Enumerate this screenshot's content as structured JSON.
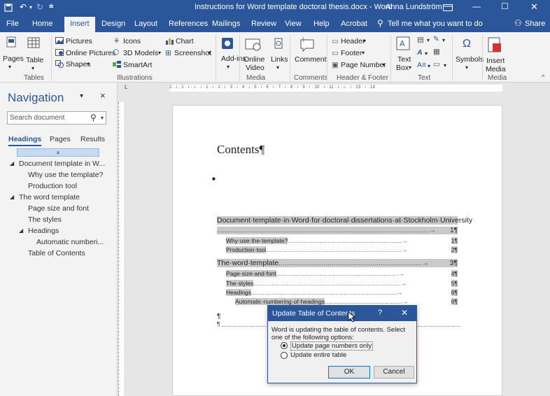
{
  "titlebar": {
    "doc_title": "Instructions for Word template doctoral thesis.docx - Word",
    "user": "Anna Lundström"
  },
  "tabs": [
    "File",
    "Home",
    "Insert",
    "Design",
    "Layout",
    "References",
    "Mailings",
    "Review",
    "View",
    "Help",
    "Acrobat"
  ],
  "tell_me": "Tell me what you want to do",
  "share": "Share",
  "ribbon": {
    "pages": "Pages",
    "table": "Table",
    "pictures": "Pictures",
    "online_pictures": "Online Pictures",
    "shapes": "Shapes",
    "icons": "Icons",
    "models": "3D Models",
    "smartart": "SmartArt",
    "chart": "Chart",
    "screenshot": "Screenshot",
    "addins": "Add-ins",
    "online_video_1": "Online",
    "online_video_2": "Video",
    "links": "Links",
    "comment": "Comment",
    "header": "Header",
    "footer": "Footer",
    "page_number": "Page Number",
    "text_box_1": "Text",
    "text_box_2": "Box",
    "symbols": "Symbols",
    "insert_media_1": "Insert",
    "insert_media_2": "Media",
    "groups": {
      "tables": "Tables",
      "illustrations": "Illustrations",
      "media": "Media",
      "comments": "Comments",
      "header_footer": "Header & Footer",
      "text": "Text",
      "media2": "Media"
    }
  },
  "nav": {
    "title": "Navigation",
    "search_placeholder": "Search document",
    "tabs": [
      "Headings",
      "Pages",
      "Results"
    ],
    "items": [
      "Document template in W...",
      "Why use the template?",
      "Production tool",
      "The word template",
      "Page size and font",
      "The styles",
      "Headings",
      "Automatic numberi...",
      "Table of Contents"
    ]
  },
  "ruler": "2 · ı · 1 · ı · ⌂ · ı · 1 · ı · 2 · ı · 3 · ı · 4 · ı · 5 · ı · 6 · ı · 7 · ı · 8 · ı · 9 · ı · 10 · ı · 11 · ı · ⌂ · ı · 13 · ı · 14",
  "document": {
    "heading": "Contents¶",
    "toc": [
      {
        "text": "Document·template·in·Word·for·doctoral·dissertations·at·Stockholm·University",
        "page": ""
      },
      {
        "text": "",
        "page": "1¶"
      },
      {
        "text": "Why·use·the·template?",
        "page": "1¶"
      },
      {
        "text": "Production·tool",
        "page": "2¶"
      },
      {
        "text": "The·word·template",
        "page": "3¶"
      },
      {
        "text": "Page·size·and·font",
        "page": "4¶"
      },
      {
        "text": "The·styles",
        "page": "5¶"
      },
      {
        "text": "Headings",
        "page": "6¶"
      },
      {
        "text": "Automatic·numbering·of·headings",
        "page": "6¶"
      }
    ],
    "pilcrow": "¶"
  },
  "dialog": {
    "title": "Update Table of Contents",
    "help": "?",
    "message": "Word is updating the table of contents.  Select one of the following options:",
    "option1": "Update page numbers only",
    "option2": "Update entire table",
    "ok": "OK",
    "cancel": "Cancel"
  },
  "colors": {
    "accent": "#2b579a"
  }
}
